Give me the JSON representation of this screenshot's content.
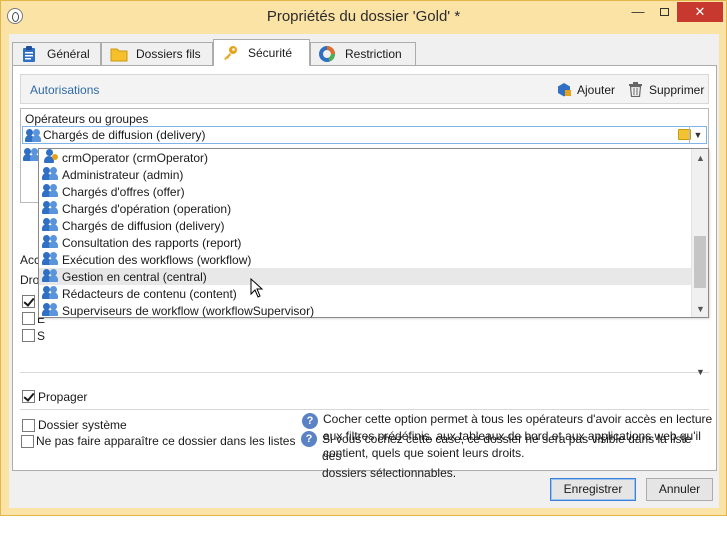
{
  "window": {
    "title": "Propriétés du dossier 'Gold' *",
    "controls": {
      "minimize": "—",
      "close": "✕"
    }
  },
  "tabs": [
    {
      "label": "Général",
      "icon": "clipboard-icon"
    },
    {
      "label": "Dossiers fils",
      "icon": "folder-icon"
    },
    {
      "label": "Sécurité",
      "icon": "key-icon"
    },
    {
      "label": "Restriction",
      "icon": "ring-chart-icon"
    }
  ],
  "active_tab": "Sécurité",
  "auth": {
    "title": "Autorisations",
    "add_label": "Ajouter",
    "delete_label": "Supprimer"
  },
  "grid": {
    "column_header": "Opérateurs ou groupes",
    "selected_value": "Chargés de diffusion (delivery)"
  },
  "dropdown": {
    "items": [
      {
        "label": "crmOperator (crmOperator)",
        "icon": "operator-icon"
      },
      {
        "label": "Administrateur (admin)",
        "icon": "group-icon"
      },
      {
        "label": "Chargés d'offres (offer)",
        "icon": "group-icon"
      },
      {
        "label": "Chargés d'opération (operation)",
        "icon": "group-icon"
      },
      {
        "label": "Chargés de diffusion (delivery)",
        "icon": "group-icon"
      },
      {
        "label": "Consultation des rapports (report)",
        "icon": "group-icon"
      },
      {
        "label": "Exécution des workflows (workflow)",
        "icon": "group-icon"
      },
      {
        "label": "Gestion en central (central)",
        "icon": "group-icon"
      },
      {
        "label": "Rédacteurs de contenu (content)",
        "icon": "group-icon"
      },
      {
        "label": "Superviseurs de workflow (workflowSupervisor)",
        "icon": "group-icon"
      }
    ],
    "hovered_item": "Gestion en central (central)"
  },
  "partial_labels": {
    "acc": "Acc",
    "droi": "Droi",
    "l": "L",
    "e": "E",
    "s": "S"
  },
  "options": {
    "propagate": {
      "label": "Propager",
      "checked": true
    },
    "system_folder": {
      "label": "Dossier système",
      "checked": false,
      "help_lines": [
        "Cocher cette option permet à tous les opérateurs d'avoir accès en lecture",
        "aux filtres prédéfinis, aux tableaux de bord et aux applications web qu'il",
        "contient, quels que soient leurs droits."
      ]
    },
    "hide_folder": {
      "label": "Ne pas faire apparaître ce dossier dans les listes",
      "checked": false,
      "help_lines": [
        "Si vous cochez cette case, ce dossier ne sera pas visible dans la liste des",
        "dossiers sélectionnables."
      ]
    }
  },
  "buttons": {
    "save": "Enregistrer",
    "cancel": "Annuler"
  },
  "colors": {
    "title_bar": "#fbe3a6",
    "close_button": "#c7392f",
    "link_blue": "#2f6aa8",
    "group_icon": "#2f6fc4",
    "help_icon": "#5b82c4"
  }
}
